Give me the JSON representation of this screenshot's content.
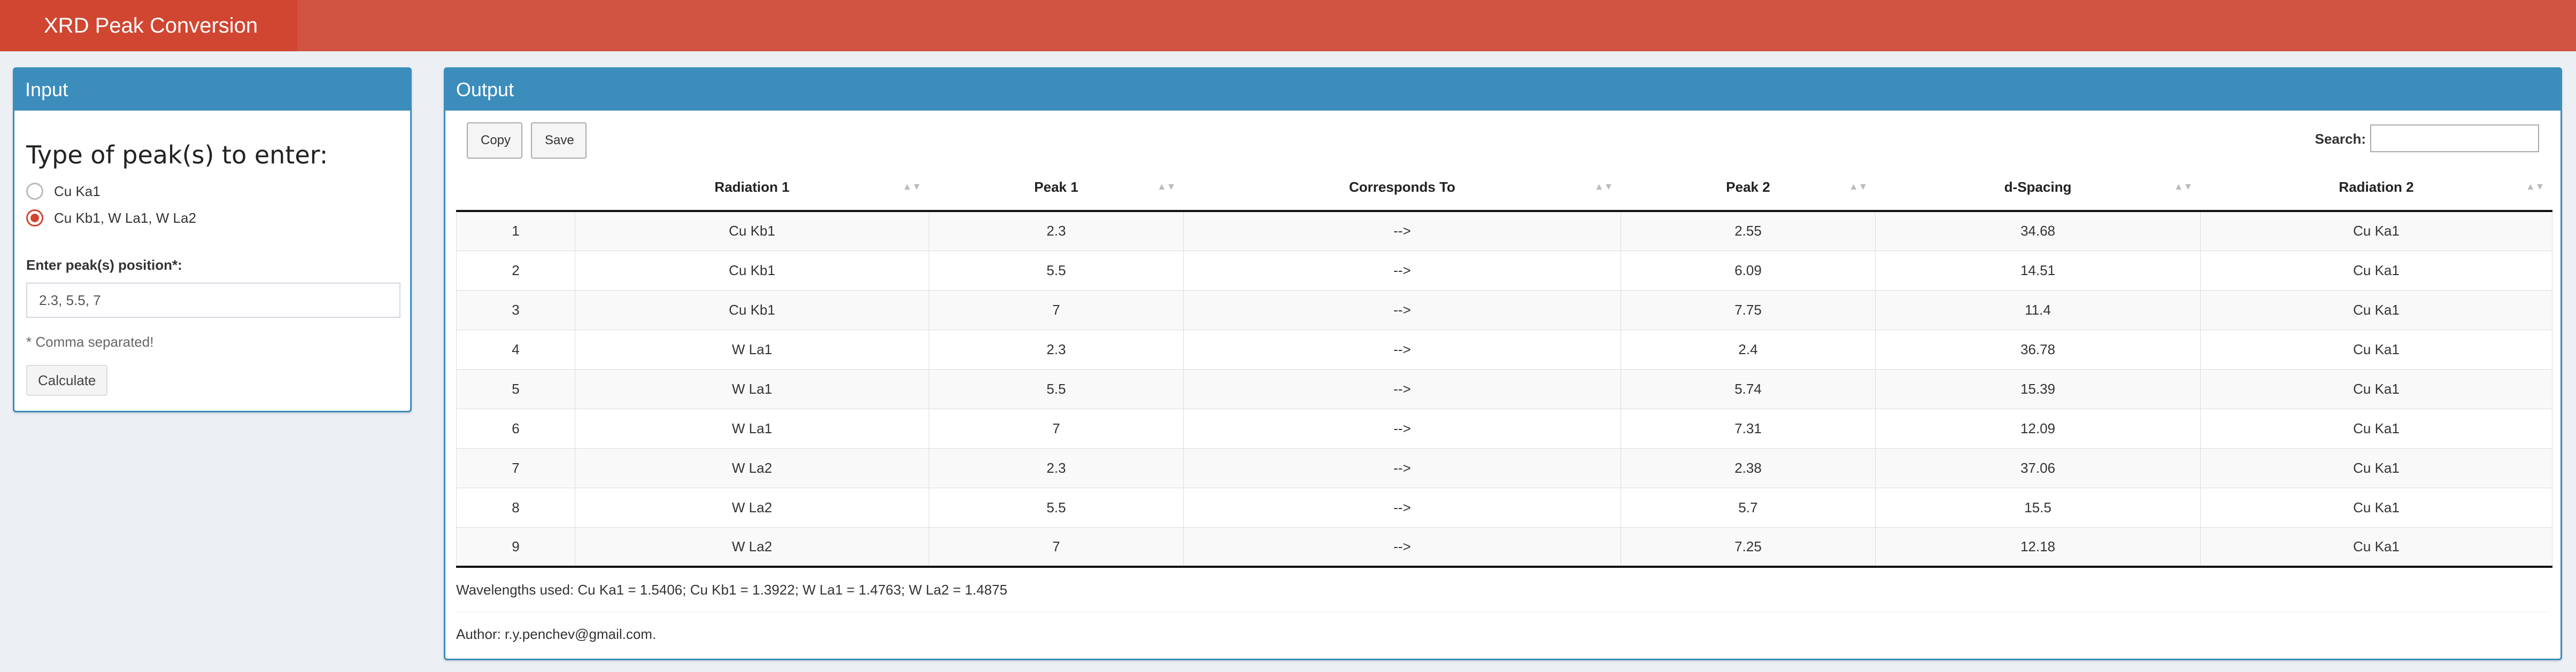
{
  "app": {
    "title": "XRD Peak Conversion"
  },
  "input": {
    "header": "Input",
    "peak_type_label": "Type of peak(s) to enter:",
    "options": [
      {
        "label": "Cu Ka1",
        "checked": false
      },
      {
        "label": "Cu Kb1, W La1, W La2",
        "checked": true
      }
    ],
    "position_label": "Enter peak(s) position*:",
    "position_value": "2.3, 5.5, 7",
    "hint": "* Comma separated!",
    "calculate_label": "Calculate"
  },
  "output": {
    "header": "Output",
    "copy_label": "Copy",
    "save_label": "Save",
    "search_label": "Search:",
    "search_value": "",
    "columns": [
      "",
      "Radiation 1",
      "Peak 1",
      "Corresponds To",
      "Peak 2",
      "d-Spacing",
      "Radiation 2"
    ],
    "rows": [
      [
        "1",
        "Cu Kb1",
        "2.3",
        "-->",
        "2.55",
        "34.68",
        "Cu Ka1"
      ],
      [
        "2",
        "Cu Kb1",
        "5.5",
        "-->",
        "6.09",
        "14.51",
        "Cu Ka1"
      ],
      [
        "3",
        "Cu Kb1",
        "7",
        "-->",
        "7.75",
        "11.4",
        "Cu Ka1"
      ],
      [
        "4",
        "W La1",
        "2.3",
        "-->",
        "2.4",
        "36.78",
        "Cu Ka1"
      ],
      [
        "5",
        "W La1",
        "5.5",
        "-->",
        "5.74",
        "15.39",
        "Cu Ka1"
      ],
      [
        "6",
        "W La1",
        "7",
        "-->",
        "7.31",
        "12.09",
        "Cu Ka1"
      ],
      [
        "7",
        "W La2",
        "2.3",
        "-->",
        "2.38",
        "37.06",
        "Cu Ka1"
      ],
      [
        "8",
        "W La2",
        "5.5",
        "-->",
        "5.7",
        "15.5",
        "Cu Ka1"
      ],
      [
        "9",
        "W La2",
        "7",
        "-->",
        "7.25",
        "12.18",
        "Cu Ka1"
      ]
    ],
    "wavelengths": "Wavelengths used: Cu Ka1 = 1.5406; Cu Kb1 = 1.3922; W La1 = 1.4763; W La2 = 1.4875",
    "author": "Author: r.y.penchev@gmail.com."
  }
}
